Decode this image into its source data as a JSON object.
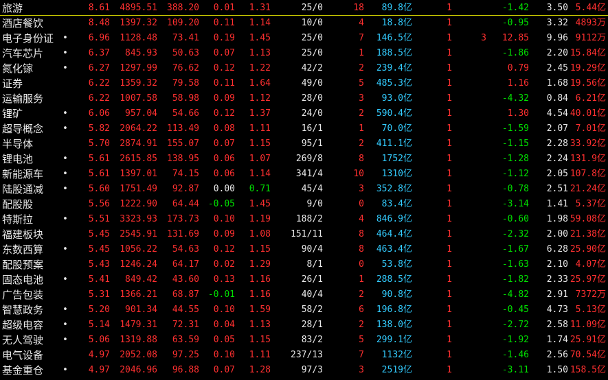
{
  "colors": {
    "background": "#000000",
    "up": "#ff3030",
    "down": "#00e000",
    "flat": "#e8e8e8",
    "amount": "#33ccff",
    "selection": "#c8c800"
  },
  "rows": [
    {
      "name": "旅游",
      "dot": "",
      "pct": "8.61",
      "price": "4895.51",
      "chg": "388.20",
      "speed": "0.01",
      "ratio": "1.31",
      "updown": "25/0",
      "limit": "18",
      "amount": "89.8",
      "amount_unit": "亿",
      "n1": "1",
      "n2": "",
      "a": "-1.42",
      "b": "3.50",
      "cap": "5.44",
      "cap_unit": "亿",
      "speed_dir": "up",
      "ratio_dir": "up",
      "a_dir": "down"
    },
    {
      "name": "酒店餐饮",
      "dot": "",
      "pct": "8.48",
      "price": "1397.32",
      "chg": "109.20",
      "speed": "0.11",
      "ratio": "1.14",
      "updown": "10/0",
      "limit": "4",
      "amount": "18.8",
      "amount_unit": "亿",
      "n1": "1",
      "n2": "",
      "a": "-0.95",
      "b": "3.32",
      "cap": "4893",
      "cap_unit": "万",
      "speed_dir": "up",
      "ratio_dir": "up",
      "a_dir": "down"
    },
    {
      "name": "电子身份证",
      "dot": "•",
      "pct": "6.96",
      "price": "1128.48",
      "chg": "73.41",
      "speed": "0.19",
      "ratio": "1.45",
      "updown": "25/0",
      "limit": "7",
      "amount": "146.5",
      "amount_unit": "亿",
      "n1": "1",
      "n2": "3",
      "a": "12.85",
      "b": "9.96",
      "cap": "9112",
      "cap_unit": "万",
      "speed_dir": "up",
      "ratio_dir": "up",
      "a_dir": "up"
    },
    {
      "name": "汽车芯片",
      "dot": "•",
      "pct": "6.37",
      "price": "845.93",
      "chg": "50.63",
      "speed": "0.07",
      "ratio": "1.13",
      "updown": "25/0",
      "limit": "1",
      "amount": "188.5",
      "amount_unit": "亿",
      "n1": "1",
      "n2": "",
      "a": "-1.86",
      "b": "2.20",
      "cap": "15.84",
      "cap_unit": "亿",
      "speed_dir": "up",
      "ratio_dir": "up",
      "a_dir": "down"
    },
    {
      "name": "氮化镓",
      "dot": "•",
      "pct": "6.27",
      "price": "1297.99",
      "chg": "76.62",
      "speed": "0.12",
      "ratio": "1.22",
      "updown": "42/2",
      "limit": "2",
      "amount": "239.4",
      "amount_unit": "亿",
      "n1": "1",
      "n2": "",
      "a": "0.79",
      "b": "2.45",
      "cap": "19.29",
      "cap_unit": "亿",
      "speed_dir": "up",
      "ratio_dir": "up",
      "a_dir": "up"
    },
    {
      "name": "证券",
      "dot": "",
      "pct": "6.22",
      "price": "1359.32",
      "chg": "79.58",
      "speed": "0.11",
      "ratio": "1.64",
      "updown": "49/0",
      "limit": "5",
      "amount": "485.3",
      "amount_unit": "亿",
      "n1": "1",
      "n2": "",
      "a": "1.16",
      "b": "1.68",
      "cap": "19.56",
      "cap_unit": "亿",
      "speed_dir": "up",
      "ratio_dir": "up",
      "a_dir": "up"
    },
    {
      "name": "运输服务",
      "dot": "",
      "pct": "6.22",
      "price": "1007.58",
      "chg": "58.98",
      "speed": "0.09",
      "ratio": "1.12",
      "updown": "28/0",
      "limit": "3",
      "amount": "93.0",
      "amount_unit": "亿",
      "n1": "1",
      "n2": "",
      "a": "-4.32",
      "b": "0.84",
      "cap": "6.21",
      "cap_unit": "亿",
      "speed_dir": "up",
      "ratio_dir": "up",
      "a_dir": "down"
    },
    {
      "name": "锂矿",
      "dot": "•",
      "pct": "6.06",
      "price": "957.04",
      "chg": "54.66",
      "speed": "0.12",
      "ratio": "1.37",
      "updown": "24/0",
      "limit": "2",
      "amount": "590.4",
      "amount_unit": "亿",
      "n1": "1",
      "n2": "",
      "a": "1.30",
      "b": "4.54",
      "cap": "40.01",
      "cap_unit": "亿",
      "speed_dir": "up",
      "ratio_dir": "up",
      "a_dir": "up"
    },
    {
      "name": "超导概念",
      "dot": "•",
      "pct": "5.82",
      "price": "2064.22",
      "chg": "113.49",
      "speed": "0.08",
      "ratio": "1.11",
      "updown": "16/1",
      "limit": "1",
      "amount": "70.0",
      "amount_unit": "亿",
      "n1": "1",
      "n2": "",
      "a": "-1.59",
      "b": "2.07",
      "cap": "7.01",
      "cap_unit": "亿",
      "speed_dir": "up",
      "ratio_dir": "up",
      "a_dir": "down"
    },
    {
      "name": "半导体",
      "dot": "",
      "pct": "5.70",
      "price": "2874.91",
      "chg": "155.07",
      "speed": "0.07",
      "ratio": "1.15",
      "updown": "95/1",
      "limit": "2",
      "amount": "411.1",
      "amount_unit": "亿",
      "n1": "1",
      "n2": "",
      "a": "-1.15",
      "b": "2.28",
      "cap": "33.92",
      "cap_unit": "亿",
      "speed_dir": "up",
      "ratio_dir": "up",
      "a_dir": "down"
    },
    {
      "name": "锂电池",
      "dot": "•",
      "pct": "5.61",
      "price": "2615.85",
      "chg": "138.95",
      "speed": "0.06",
      "ratio": "1.07",
      "updown": "269/8",
      "limit": "8",
      "amount": "1752",
      "amount_unit": "亿",
      "n1": "1",
      "n2": "",
      "a": "-1.28",
      "b": "2.24",
      "cap": "131.9",
      "cap_unit": "亿",
      "speed_dir": "up",
      "ratio_dir": "up",
      "a_dir": "down"
    },
    {
      "name": "新能源车",
      "dot": "•",
      "pct": "5.61",
      "price": "1397.01",
      "chg": "74.15",
      "speed": "0.06",
      "ratio": "1.14",
      "updown": "341/4",
      "limit": "10",
      "amount": "1310",
      "amount_unit": "亿",
      "n1": "1",
      "n2": "",
      "a": "-1.12",
      "b": "2.05",
      "cap": "107.8",
      "cap_unit": "亿",
      "speed_dir": "up",
      "ratio_dir": "up",
      "a_dir": "down"
    },
    {
      "name": "陆股通减",
      "dot": "•",
      "pct": "5.60",
      "price": "1751.49",
      "chg": "92.87",
      "speed": "0.00",
      "ratio": "0.71",
      "updown": "45/4",
      "limit": "3",
      "amount": "352.8",
      "amount_unit": "亿",
      "n1": "1",
      "n2": "",
      "a": "-0.78",
      "b": "2.51",
      "cap": "21.24",
      "cap_unit": "亿",
      "speed_dir": "flat",
      "ratio_dir": "down",
      "a_dir": "down"
    },
    {
      "name": "配股股",
      "dot": "",
      "pct": "5.56",
      "price": "1222.90",
      "chg": "64.44",
      "speed": "-0.05",
      "ratio": "1.45",
      "updown": "9/0",
      "limit": "0",
      "amount": "83.4",
      "amount_unit": "亿",
      "n1": "1",
      "n2": "",
      "a": "-3.14",
      "b": "1.41",
      "cap": "5.37",
      "cap_unit": "亿",
      "speed_dir": "down",
      "ratio_dir": "up",
      "a_dir": "down"
    },
    {
      "name": "特斯拉",
      "dot": "•",
      "pct": "5.51",
      "price": "3323.93",
      "chg": "173.73",
      "speed": "0.10",
      "ratio": "1.19",
      "updown": "188/2",
      "limit": "4",
      "amount": "846.9",
      "amount_unit": "亿",
      "n1": "1",
      "n2": "",
      "a": "-0.60",
      "b": "1.98",
      "cap": "59.08",
      "cap_unit": "亿",
      "speed_dir": "up",
      "ratio_dir": "up",
      "a_dir": "down"
    },
    {
      "name": "福建板块",
      "dot": "",
      "pct": "5.45",
      "price": "2545.91",
      "chg": "131.69",
      "speed": "0.09",
      "ratio": "1.08",
      "updown": "151/11",
      "limit": "8",
      "amount": "464.4",
      "amount_unit": "亿",
      "n1": "1",
      "n2": "",
      "a": "-2.32",
      "b": "2.00",
      "cap": "21.38",
      "cap_unit": "亿",
      "speed_dir": "up",
      "ratio_dir": "up",
      "a_dir": "down"
    },
    {
      "name": "东数西算",
      "dot": "•",
      "pct": "5.45",
      "price": "1056.22",
      "chg": "54.63",
      "speed": "0.12",
      "ratio": "1.15",
      "updown": "90/4",
      "limit": "8",
      "amount": "463.4",
      "amount_unit": "亿",
      "n1": "1",
      "n2": "",
      "a": "-1.67",
      "b": "6.28",
      "cap": "25.90",
      "cap_unit": "亿",
      "speed_dir": "up",
      "ratio_dir": "up",
      "a_dir": "down"
    },
    {
      "name": "配股预案",
      "dot": "",
      "pct": "5.43",
      "price": "1246.24",
      "chg": "64.17",
      "speed": "0.02",
      "ratio": "1.29",
      "updown": "8/1",
      "limit": "0",
      "amount": "53.8",
      "amount_unit": "亿",
      "n1": "1",
      "n2": "",
      "a": "-1.63",
      "b": "2.10",
      "cap": "4.07",
      "cap_unit": "亿",
      "speed_dir": "up",
      "ratio_dir": "up",
      "a_dir": "down"
    },
    {
      "name": "固态电池",
      "dot": "•",
      "pct": "5.41",
      "price": "849.42",
      "chg": "43.60",
      "speed": "0.13",
      "ratio": "1.16",
      "updown": "26/1",
      "limit": "1",
      "amount": "288.5",
      "amount_unit": "亿",
      "n1": "1",
      "n2": "",
      "a": "-1.82",
      "b": "2.33",
      "cap": "25.97",
      "cap_unit": "亿",
      "speed_dir": "up",
      "ratio_dir": "up",
      "a_dir": "down"
    },
    {
      "name": "广告包装",
      "dot": "",
      "pct": "5.31",
      "price": "1366.21",
      "chg": "68.87",
      "speed": "-0.01",
      "ratio": "1.16",
      "updown": "40/4",
      "limit": "2",
      "amount": "90.8",
      "amount_unit": "亿",
      "n1": "1",
      "n2": "",
      "a": "-4.82",
      "b": "2.91",
      "cap": "7372",
      "cap_unit": "万",
      "speed_dir": "down",
      "ratio_dir": "up",
      "a_dir": "down"
    },
    {
      "name": "智慧政务",
      "dot": "•",
      "pct": "5.20",
      "price": "901.34",
      "chg": "44.55",
      "speed": "0.10",
      "ratio": "1.59",
      "updown": "58/2",
      "limit": "6",
      "amount": "196.8",
      "amount_unit": "亿",
      "n1": "1",
      "n2": "",
      "a": "-0.45",
      "b": "4.73",
      "cap": "5.13",
      "cap_unit": "亿",
      "speed_dir": "up",
      "ratio_dir": "up",
      "a_dir": "down"
    },
    {
      "name": "超级电容",
      "dot": "•",
      "pct": "5.14",
      "price": "1479.31",
      "chg": "72.31",
      "speed": "0.04",
      "ratio": "1.13",
      "updown": "28/1",
      "limit": "2",
      "amount": "138.0",
      "amount_unit": "亿",
      "n1": "1",
      "n2": "",
      "a": "-2.72",
      "b": "2.58",
      "cap": "11.09",
      "cap_unit": "亿",
      "speed_dir": "up",
      "ratio_dir": "up",
      "a_dir": "down"
    },
    {
      "name": "无人驾驶",
      "dot": "•",
      "pct": "5.06",
      "price": "1319.88",
      "chg": "63.59",
      "speed": "0.05",
      "ratio": "1.15",
      "updown": "83/2",
      "limit": "5",
      "amount": "299.1",
      "amount_unit": "亿",
      "n1": "1",
      "n2": "",
      "a": "-1.92",
      "b": "1.74",
      "cap": "25.91",
      "cap_unit": "亿",
      "speed_dir": "up",
      "ratio_dir": "up",
      "a_dir": "down"
    },
    {
      "name": "电气设备",
      "dot": "",
      "pct": "4.97",
      "price": "2052.08",
      "chg": "97.25",
      "speed": "0.10",
      "ratio": "1.11",
      "updown": "237/13",
      "limit": "7",
      "amount": "1132",
      "amount_unit": "亿",
      "n1": "1",
      "n2": "",
      "a": "-1.46",
      "b": "2.56",
      "cap": "70.54",
      "cap_unit": "亿",
      "speed_dir": "up",
      "ratio_dir": "up",
      "a_dir": "down"
    },
    {
      "name": "基金重仓",
      "dot": "•",
      "pct": "4.97",
      "price": "2046.96",
      "chg": "96.88",
      "speed": "0.07",
      "ratio": "1.28",
      "updown": "97/3",
      "limit": "3",
      "amount": "2519",
      "amount_unit": "亿",
      "n1": "1",
      "n2": "",
      "a": "-3.11",
      "b": "1.50",
      "cap": "158.5",
      "cap_unit": "亿",
      "speed_dir": "up",
      "ratio_dir": "up",
      "a_dir": "down"
    }
  ]
}
